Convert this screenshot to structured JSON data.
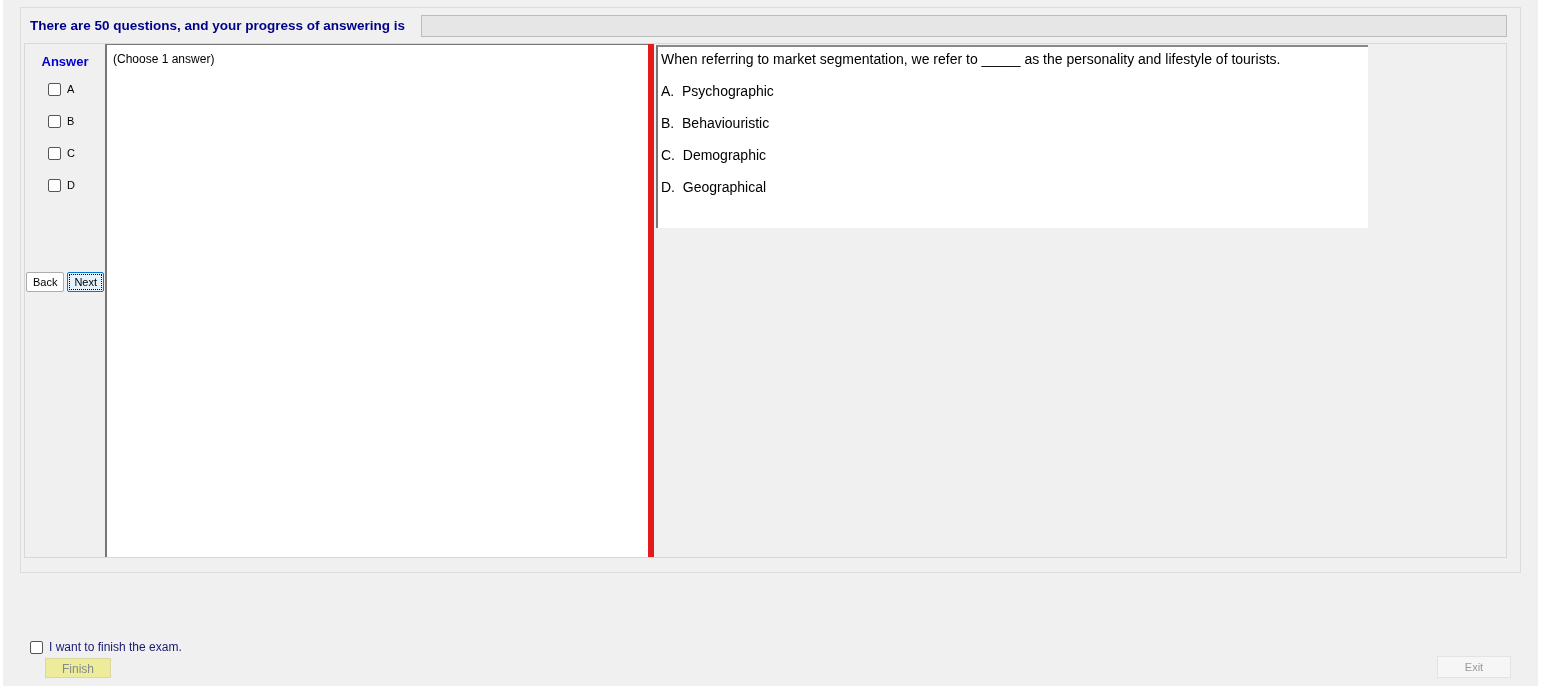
{
  "header": {
    "progress_text": "There are 50 questions, and your progress of answering is",
    "progress": {
      "level": 0
    }
  },
  "answer_panel": {
    "title": "Answer",
    "options": [
      {
        "label": "A",
        "checked": false
      },
      {
        "label": "B",
        "checked": false
      },
      {
        "label": "C",
        "checked": false
      },
      {
        "label": "D",
        "checked": false
      }
    ],
    "buttons": [
      {
        "label": "Back",
        "focused": false
      },
      {
        "label": "Next",
        "focused": true
      }
    ]
  },
  "instruction": "(Choose 1 answer)",
  "question": {
    "text": "When referring to market segmentation, we refer to _____ as the personality and lifestyle of tourists.",
    "choices": [
      "A.  Psychographic",
      "B.  Behaviouristic",
      "C.  Demographic",
      "D.  Geographical"
    ]
  },
  "finish": {
    "checkbox_label": "I want to finish the exam.",
    "checked": false,
    "finish_button": "Finish",
    "exit_button": "Exit"
  }
}
